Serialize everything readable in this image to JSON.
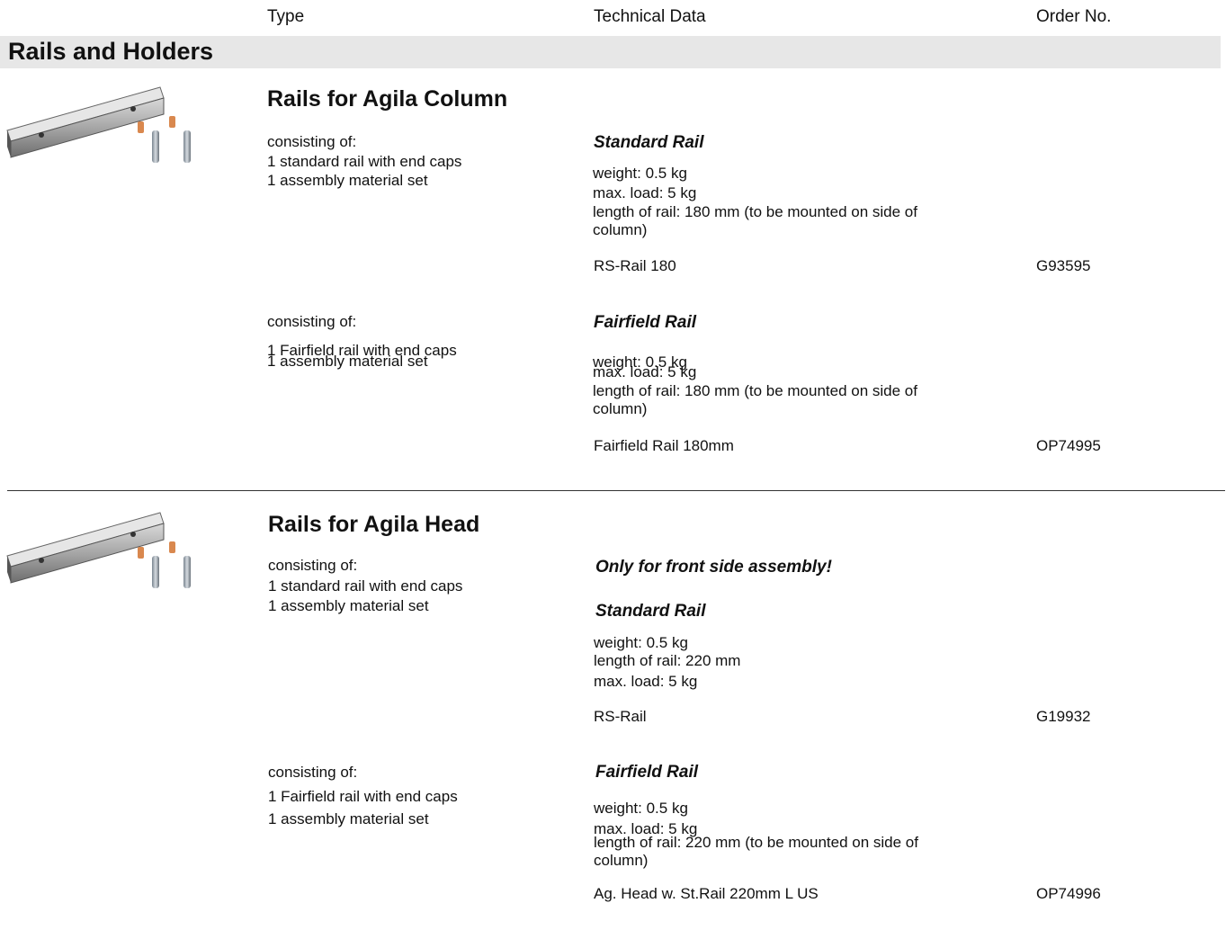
{
  "header": {
    "type": "Type",
    "technical": "Technical Data",
    "order": "Order No."
  },
  "section_title": "Rails and Holders",
  "product1": {
    "title": "Rails for Agila Column",
    "item1": {
      "consisting": "consisting of:",
      "line1": "1 standard rail with end caps",
      "line2": "1 assembly material set",
      "heading": "Standard Rail",
      "weight": "weight: 0.5 kg",
      "load": "max. load: 5 kg",
      "length": "length of rail: 180 mm (to be mounted on side of column)",
      "name": "RS-Rail 180",
      "order": "G93595"
    },
    "item2": {
      "consisting": "consisting of:",
      "line1": "1 Fairfield rail with end caps",
      "line2": "1 assembly material set",
      "heading": "Fairfield Rail",
      "weight": "weight: 0.5 kg",
      "load": "max. load: 5 kg",
      "length": "length of rail: 180 mm (to be mounted on side of column)",
      "name": "Fairfield Rail 180mm",
      "order": "OP74995"
    }
  },
  "product2": {
    "title": "Rails for Agila Head",
    "note": "Only for front side assembly!",
    "item1": {
      "consisting": "consisting of:",
      "line1": "1 standard rail with end caps",
      "line2": "1 assembly material set",
      "heading": "Standard Rail",
      "weight": "weight: 0.5 kg",
      "length": "length of rail: 220 mm",
      "load": "max. load: 5 kg",
      "name": "RS-Rail",
      "order": "G19932"
    },
    "item2": {
      "consisting": "consisting of:",
      "line1": "1 Fairfield rail with end caps",
      "line2": "1 assembly material set",
      "heading": "Fairfield Rail",
      "weight": "weight: 0.5 kg",
      "load": "max. load: 5 kg",
      "length": "length of rail: 220 mm (to be mounted on side of column)",
      "name": "Ag. Head w. St.Rail 220mm L US",
      "order": "OP74996"
    }
  }
}
